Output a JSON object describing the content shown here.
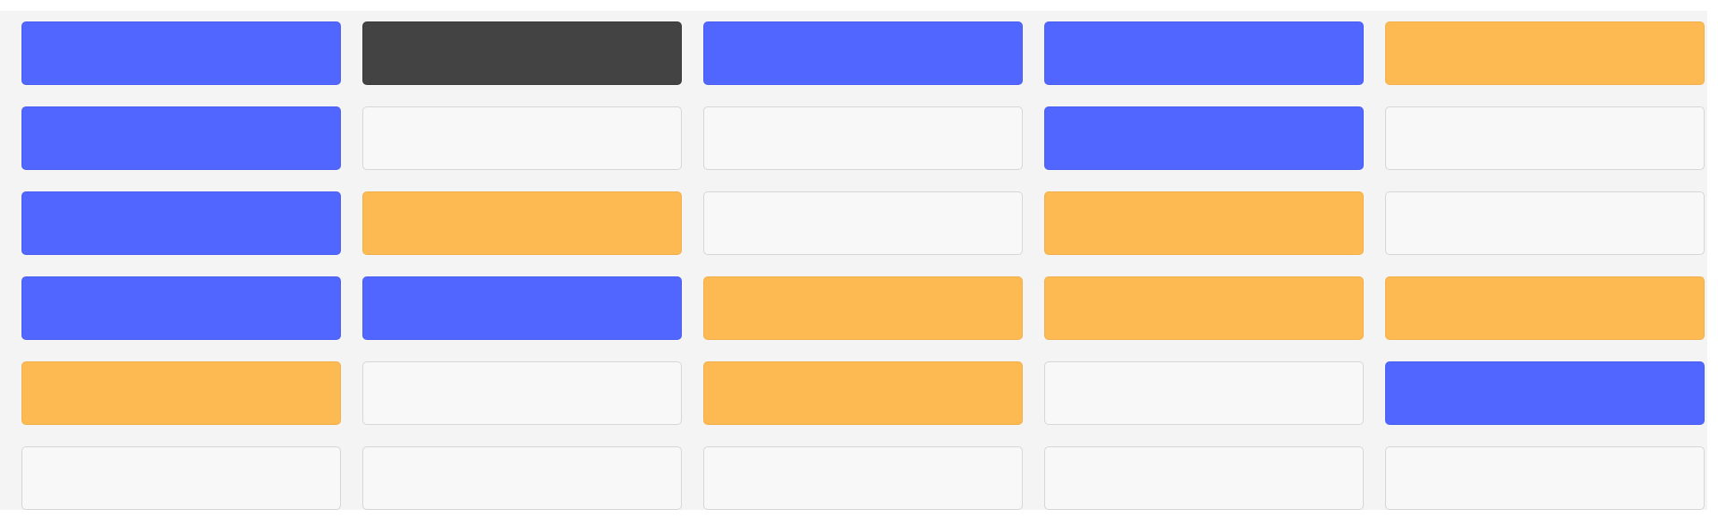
{
  "board": {
    "rows": 6,
    "columns": 5,
    "cells": [
      [
        "blue",
        "dark",
        "blue",
        "blue",
        "orange"
      ],
      [
        "blue",
        "empty",
        "empty",
        "blue",
        "empty"
      ],
      [
        "blue",
        "orange",
        "empty",
        "orange",
        "empty"
      ],
      [
        "blue",
        "blue",
        "orange",
        "orange",
        "orange"
      ],
      [
        "orange",
        "empty",
        "orange",
        "empty",
        "blue"
      ],
      [
        "empty",
        "empty",
        "empty",
        "empty",
        "empty"
      ]
    ]
  },
  "colors": {
    "blue": "#5066fe",
    "orange": "#fdba52",
    "dark": "#434343",
    "empty": "#f8f8f8",
    "board_background": "#f4f4f4"
  }
}
